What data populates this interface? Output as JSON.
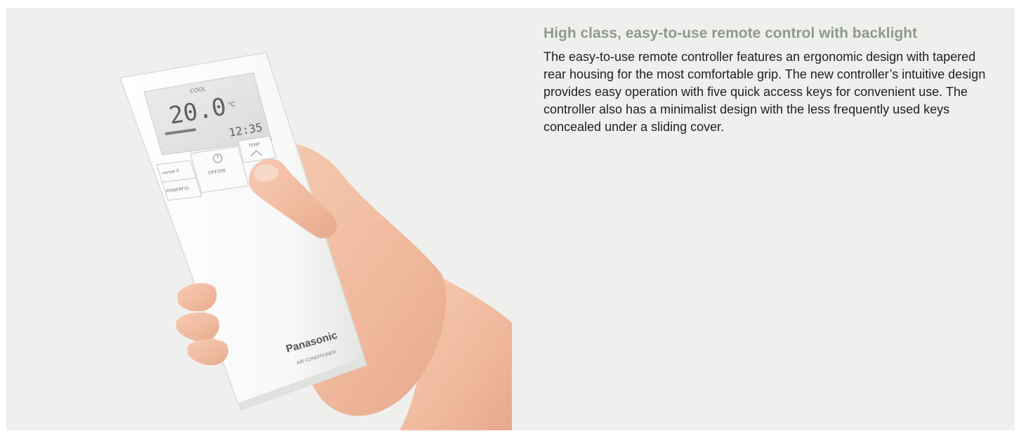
{
  "feature": {
    "title": "High class, easy-to-use remote control with backlight",
    "description": "The easy-to-use remote controller features an ergonomic design with tapered rear housing for the most comfortable grip. The new controller’s intuitive design provides easy operation with five quick access keys for convenient use. The controller also has a minimalist design with the less frequently used keys concealed under a sliding cover."
  },
  "remote": {
    "mode_label": "COOL",
    "temperature_value": "20.0",
    "temperature_unit": "°C",
    "clock_value": "12:35",
    "button_nanoe": "nanoe X",
    "button_powerful": "POWERFUL",
    "button_power": "OFF/ON",
    "button_temp": "TEMP",
    "brand": "Panasonic",
    "product": "AIR CONDITIONER"
  },
  "colors": {
    "panel_background": "#eff0ee",
    "title": "#8f9a8d",
    "body_text": "#1f1f1f",
    "remote_body": "#f8f9f8",
    "lcd": "#e4e5e3",
    "skin": "#f3c0a6"
  }
}
